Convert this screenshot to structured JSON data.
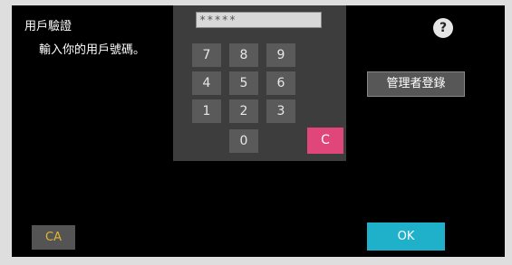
{
  "header": {
    "title": "用戶驗證",
    "help_glyph": "?",
    "help_icon": "question-circle-icon"
  },
  "prompt": "輸入你的用戶號碼。",
  "password_field": {
    "value": "*****"
  },
  "keypad": {
    "keys": [
      "7",
      "8",
      "9",
      "4",
      "5",
      "6",
      "1",
      "2",
      "3",
      "0"
    ],
    "clear_label": "C",
    "clear_color": "#e0467a"
  },
  "buttons": {
    "admin_login": "管理者登錄",
    "ca": "CA",
    "ok": "OK"
  },
  "colors": {
    "ok": "#1fb1c9",
    "ca_text": "#e0b530",
    "screen_bg": "#000000"
  }
}
